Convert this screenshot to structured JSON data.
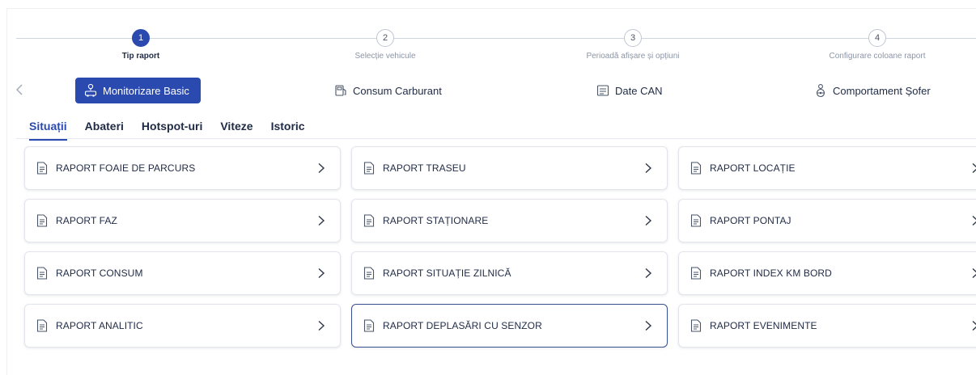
{
  "stepper": {
    "steps": [
      {
        "number": "1",
        "label": "Tip raport",
        "active": true
      },
      {
        "number": "2",
        "label": "Selecție vehicule",
        "active": false
      },
      {
        "number": "3",
        "label": "Perioadă afișare și opțiuni",
        "active": false
      },
      {
        "number": "4",
        "label": "Configurare coloane raport",
        "active": false
      }
    ]
  },
  "categories": {
    "prev_icon": "chevron-left-icon",
    "items": [
      {
        "label": "Monitorizare Basic",
        "icon": "car-pin-icon",
        "active": true
      },
      {
        "label": "Consum Carburant",
        "icon": "fuel-pump-icon",
        "active": false
      },
      {
        "label": "Date CAN",
        "icon": "can-bus-icon",
        "active": false
      },
      {
        "label": "Comportament Șofer",
        "icon": "driver-icon",
        "active": false
      }
    ]
  },
  "tabs": [
    {
      "label": "Situații",
      "active": true
    },
    {
      "label": "Abateri",
      "active": false
    },
    {
      "label": "Hotspot-uri",
      "active": false
    },
    {
      "label": "Viteze",
      "active": false
    },
    {
      "label": "Istoric",
      "active": false
    }
  ],
  "reports": [
    {
      "label": "RAPORT FOAIE DE PARCURS"
    },
    {
      "label": "RAPORT TRASEU"
    },
    {
      "label": "RAPORT LOCAȚIE"
    },
    {
      "label": "RAPORT FAZ"
    },
    {
      "label": "RAPORT STAȚIONARE"
    },
    {
      "label": "RAPORT PONTAJ"
    },
    {
      "label": "RAPORT CONSUM"
    },
    {
      "label": "RAPORT SITUAȚIE ZILNICĂ"
    },
    {
      "label": "RAPORT INDEX KM BORD"
    },
    {
      "label": "RAPORT ANALITIC"
    },
    {
      "label": "RAPORT DEPLASĂRI CU SENZOR",
      "highlighted": true
    },
    {
      "label": "RAPORT EVENIMENTE"
    }
  ],
  "colors": {
    "accent": "#2b4ab0",
    "text": "#1f2a44",
    "muted": "#8c95a5",
    "highlight_border": "#3a4f8f"
  }
}
